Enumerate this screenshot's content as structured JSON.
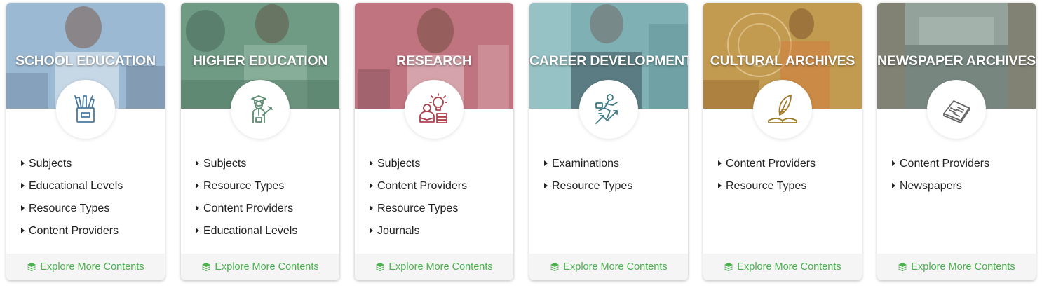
{
  "accent_color": "#4caf50",
  "cards": [
    {
      "title": "SCHOOL EDUCATION",
      "icon": "school-supplies-icon",
      "links": [
        "Subjects",
        "Educational Levels",
        "Resource Types",
        "Content Providers"
      ],
      "explore_label": "Explore More Contents",
      "tint": "#9fbad3"
    },
    {
      "title": "HIGHER EDUCATION",
      "icon": "graduate-icon",
      "links": [
        "Subjects",
        "Resource Types",
        "Content Providers",
        "Educational Levels"
      ],
      "explore_label": "Explore More Contents",
      "tint": "#5f8f77"
    },
    {
      "title": "RESEARCH",
      "icon": "research-idea-icon",
      "links": [
        "Subjects",
        "Content Providers",
        "Resource Types",
        "Journals"
      ],
      "explore_label": "Explore More Contents",
      "tint": "#bf6f7c"
    },
    {
      "title": "CAREER DEVELOPMENT",
      "icon": "career-growth-icon",
      "links": [
        "Examinations",
        "Resource Types"
      ],
      "explore_label": "Explore More Contents",
      "tint": "#6fa1a6"
    },
    {
      "title": "CULTURAL ARCHIVES",
      "icon": "quill-book-icon",
      "links": [
        "Content Providers",
        "Resource Types"
      ],
      "explore_label": "Explore More Contents",
      "tint": "#c39a4c"
    },
    {
      "title": "NEWSPAPER ARCHIVES",
      "icon": "newspaper-icon",
      "links": [
        "Content Providers",
        "Newspapers"
      ],
      "explore_label": "Explore More Contents",
      "tint": "#8a9a92"
    }
  ]
}
